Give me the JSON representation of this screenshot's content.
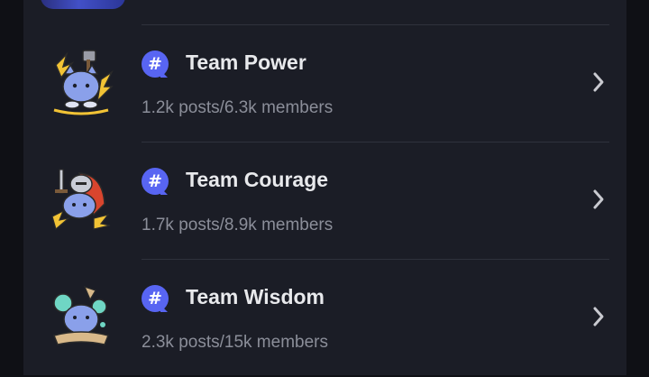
{
  "colors": {
    "background": "#0f1015",
    "panel": "#1b1d26",
    "divider": "#2f323c",
    "title_text": "#e8e9ec",
    "meta_text": "#8b8e99",
    "badge": "#5865f2",
    "chevron": "#c9cad0"
  },
  "communities": [
    {
      "name": "Team Power",
      "stats": "1.2k posts/6.3k members",
      "badge_icon": "hashtag-icon",
      "avatar_icon": "team-power-mascot-icon",
      "accent": "#f2c335"
    },
    {
      "name": "Team Courage",
      "stats": "1.7k posts/8.9k members",
      "badge_icon": "hashtag-icon",
      "avatar_icon": "team-courage-mascot-icon",
      "accent": "#d8452e"
    },
    {
      "name": "Team Wisdom",
      "stats": "2.3k posts/15k members",
      "badge_icon": "hashtag-icon",
      "avatar_icon": "team-wisdom-mascot-icon",
      "accent": "#6fd6c4"
    }
  ]
}
